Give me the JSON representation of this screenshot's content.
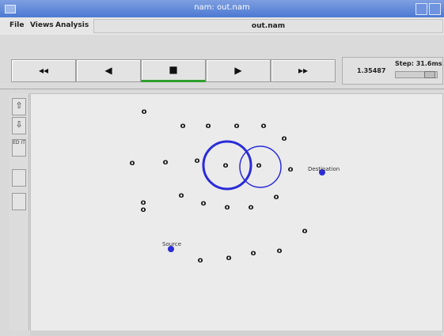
{
  "window": {
    "title": "nam: out.nam"
  },
  "menubar": {
    "file": "File",
    "views": "Views",
    "analysis": "Analysis",
    "filename": "out.nam"
  },
  "playback": {
    "rewind_fast": "◂◂",
    "rewind": "◀",
    "stop": "■",
    "play": "▶",
    "forward_fast": "▸▸",
    "time": "1.35487",
    "step": "Step: 31.6ms"
  },
  "tools": {
    "zoom_in": "⇧",
    "zoom_out": "⇩",
    "edit": "ED IT"
  },
  "graph": {
    "node_glyph": "o",
    "source_label": "Source",
    "destination_label": "Destination",
    "highlight_color": "#2b2bd9"
  }
}
